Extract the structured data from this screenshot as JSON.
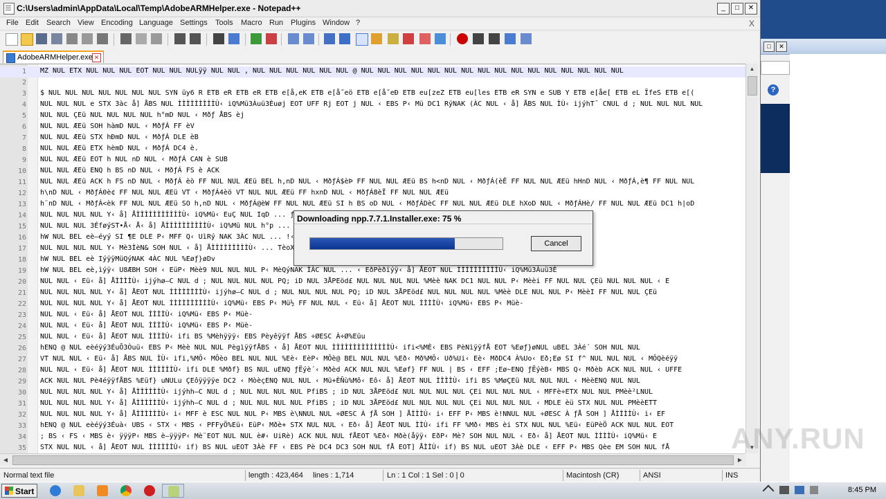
{
  "window": {
    "title": "C:\\Users\\admin\\AppData\\Local\\Temp\\AdobeARMHelper.exe - Notepad++",
    "close_doc": "X"
  },
  "menu": [
    "File",
    "Edit",
    "Search",
    "View",
    "Encoding",
    "Language",
    "Settings",
    "Tools",
    "Macro",
    "Run",
    "Plugins",
    "Window",
    "?"
  ],
  "tab": {
    "label": "AdobeARMHelper.exe"
  },
  "editor": {
    "lines": [
      {
        "n": "1",
        "t": "MZ NUL ETX NUL NUL NUL EOT NUL NUL NULÿÿ NUL NUL , NUL NUL NUL NUL NUL NUL @ NUL NUL NUL NUL NUL NUL NUL NUL NUL NUL NUL NUL NUL NUL NUL NUL"
      },
      {
        "n": "2",
        "t": ""
      },
      {
        "n": "3",
        "t": "$ NUL NUL NUL NUL NUL NUL NUL SYN üy6 R ETB eR ETB eR ETB e[å,eK ETB e[å˝eö ETB e[å˝eÐ ETB eu[zeZ ETB eu[les ETB eR SYN e SUB Y ETB e[åe[ ETB eL ÏfeS ETB e[("
      },
      {
        "n": "4",
        "t": "NUL NUL NUL e STX 3àc å] ÅBS NUL ÌÌÌÌÌÌÌÌÌÙ‹ iQ%Mü3Àuü3Èuøj EOT UFF Rj EOT j NUL ‹ EBS P‹ Mü DC1 RýNAK (ÀC NUL ‹ å] ÅBS NUL ÌÙ‹ ijýhT¯ CNUL d ; NUL NUL NUL NUL"
      },
      {
        "n": "5",
        "t": "NUL NUL ÇEü NUL NUL NUL NUL h°mD NUL ‹ Mðƒ ÅBS èj"
      },
      {
        "n": "6",
        "t": "NUL NUL ÆEü SOH hàmD NUL ‹ MðƒÁ FF èV"
      },
      {
        "n": "7",
        "t": "NUL NUL ÆEü STX hÐmD NUL ‹ MðƒÁ DLE èB"
      },
      {
        "n": "8",
        "t": "NUL NUL ÆEü ETX hèmD NUL ‹ MðƒÁ DC4 è."
      },
      {
        "n": "9",
        "t": "NUL NUL ÆEü EOT h NUL nD NUL ‹ MðƒÁ CAN è SUB"
      },
      {
        "n": "10",
        "t": "NUL NUL ÆEü ENQ h BS nD NUL ‹ MðƒÁ FS è ACK"
      },
      {
        "n": "11",
        "t": "NUL NUL ÆEü ACK h FS nD NUL ‹ MðƒÁ  èò FF NUL NUL ÆEü BEL h,nD NUL ‹ MðƒÁ$èÞ FF NUL NUL ÆEü BS h<nD NUL ‹ MðƒÁ(èÊ FF NUL NUL ÆEü  hHnD NUL ‹ MðƒÁ,è¶ FF NUL NUL"
      },
      {
        "n": "12",
        "t": "h\\nD NUL ‹ MðƒÁ0è¢ FF NUL NUL ÆEü VT ‹ MðƒÁ4èö VT NUL NUL ÆEü FF hxnD NUL ‹ MðƒÁ8èÏ FF NUL NUL ÆEü"
      },
      {
        "n": "13",
        "t": "h¨nD NUL ‹ MðƒÁ<èk FF NUL NUL ÆEü SO h,nD NUL ‹ MðƒÁ@èW FF NUL NUL ÆEü SI h BS oD NUL ‹ MðƒÁDèC FF NUL NUL ÆEü DLE hXoD NUL ‹ MðƒÁHè/ FF NUL NUL ÆEü DC1 h|oD"
      },
      {
        "n": "14",
        "t": "NUL NUL NUL NUL Y‹ å] ÅÌÌÌÌÌÌÌÌÌÌÌÙ‹ iQ%Mü‹ EuÇ NUL IqD ...  ƒÁèT^ NUL NUL ‹ MüƒÁdèI^ NUL NUL"
      },
      {
        "n": "15",
        "t": "NUL NUL NUL 3ÉføýST•Å‹ Å‹ å] ÅÌÌÌÌÌÌÌÌÌÌÙ‹ iQ%Mü NUL h°p ...  üj NUL h°pD NUL ‹ MüƒÁ EOT è°FF NUL"
      },
      {
        "n": "16",
        "t": "hW NUL BEL eè—éyý SI ¶E DLE P‹ MFF Q‹ UìRý NAK 3ÀC NUL ...  !‹ EðƒÁ EOT %Eð‹ MQ‹ UìRýNAK |ÀC"
      },
      {
        "n": "17",
        "t": "NUL NUL NUL NUL Y‹ Mè3ÌèN& SOH NUL ‹ å] ÅÌÌÌÌÌÌÌÌÌÙ‹ ...  TèoX NUL NUL ‹ MüƒÁPèdX NUL NUL ‹"
      },
      {
        "n": "18",
        "t": "hW NUL BEL eè IýÿÿMüQýNAK 4ÀC NUL %Eøƒ}øDv"
      },
      {
        "n": "19",
        "t": "hW NUL BEL eè,ìýÿ‹ U8ÆBH SOH ‹ EüP‹ Mèè9 NUL NUL NUL P‹ MèQýNAK ÌÀC NUL ... ‹ EðPèðïýÿ‹ å] ÅEOT NUL ÌÌÌÌÌÌÌÌÌÌÙ‹ iQ%Mü3Àuü3È"
      },
      {
        "n": "20",
        "t": "NUL NUL ‹ Eü‹ å] ÅÌÌÌÌÙ‹ ijýhø—C NUL d ; NUL NUL NUL NUL PQ; iD NUL 3ÅPEöd£ NUL NUL NUL NUL %Mèè NAK DC1 NUL NUL P‹ Mèèi FF NUL NUL ÇEü NUL NUL NUL ‹ E"
      },
      {
        "n": "21",
        "t": "NUL NUL NUL NUL Y‹ å] ÅEOT NUL ÌÌÌÌÌÌÌÌÙ‹ ijýhø—C NUL d ; NUL NUL NUL NUL PQ; iD NUL 3ÅPEöd£ NUL NUL NUL NUL %Mèè DLE NUL NUL P‹ MèèI FF NUL NUL ÇEü"
      },
      {
        "n": "22",
        "t": "NUL NUL NUL NUL Y‹ å] ÅEOT NUL ÌÌÌÌÌÌÌÌÌÌÙ‹ iQ%Mü‹ EBS P‹ Mü½ FF NUL NUL ‹ Eü‹ å] ÅEOT NUL ÌÌÌÌÙ‹ iQ%Mü‹ EBS P‹ Müè-"
      },
      {
        "n": "23",
        "t": "NUL NUL ‹ Eü‹ å] ÅEOT NUL ÌÌÌÌÙ‹ iQ%Mü‹ EBS P‹ Müè-"
      },
      {
        "n": "24",
        "t": "NUL NUL ‹ Eü‹ å] ÅEOT NUL ÌÌÌÌÙ‹ iQ%Mü‹ EBS P‹ Müè-"
      },
      {
        "n": "25",
        "t": "NUL NUL ‹ Eü‹ å] ÅEOT NUL ÌÌÌÌÙ‹ ifi BS %Mèhÿÿÿ‹ EBS Pèyêÿÿf ÅBS ÷ØESC À÷Ø%Eüu"
      },
      {
        "n": "26",
        "t": "hENQ @ NUL eèéÿý3ÉuÕ3Òuü‹ EBS P‹ Mèè NUL NUL PègìÿÿfÅBS ‹ å] ÅEOT NUL ÌÌÌÌÌÌÌÌÌÌÌÌÌÌÙ‹ ifi<%MÈ‹ EBS PèNìÿÿfÅ EOT %Eøƒ}øNUL uBEL 3Àé´ SOH NUL NUL"
      },
      {
        "n": "27",
        "t": "VT NUL NUL ‹ Eü‹ å] ÅBS NUL ÌÙ‹ ifi,%MÔ‹ MÔèo BEL NUL NUL %Eè‹ EèP‹ MÔè@ BEL NUL NUL %Eð‹ Mð%MÔ‹ Uð%Ui‹ Eè‹ MðDC4 À%Uo‹ Eð;Eø SI f^ NUL NUL NUL ‹ MÔQèéÿÿ"
      },
      {
        "n": "28",
        "t": "NUL NUL ‹ Eü‹ å] ÅEOT NUL ÌÌÌÌÌÌÙ‹ ifi DLE %Mðf} BS NUL uENQ ƒËýè´‹ Mðèd ACK NUL NUL %Eøf} FF NUL | BS ‹ EFF ;Eø~ENQ ƒËýèB‹ MBS Q‹ Mðèb ACK NUL NUL ‹ UFFE"
      },
      {
        "n": "29",
        "t": "ACK NUL NUL Pè4éÿÿfÅBS %Eüf} uNULu ÇEôÿÿÿÿe DC2 ‹ MòèçENQ NUL NUL ‹ Mü+ÈÑù%Mô‹ Eô‹ å] ÅEOT NUL ÌÌÌÌÙ‹ ifi BS %MøÇEü NUL NUL NUL ‹ MèèENQ NUL NUL"
      },
      {
        "n": "30",
        "t": "NUL NUL NUL NUL Y‹ å] ÅÌÌÌÌÌÌÙ‹ ijýhh—C NUL d ; NUL NUL NUL NUL PfiBS ; iD NUL 3ÅPEöd£ NUL NUL NUL NUL ÇEi NUL NUL NUL ‹ MFFè÷ETX NUL NUL PMèè²LNUL"
      },
      {
        "n": "31",
        "t": "NUL NUL NUL NUL Y‹ å] ÅÌÌÌÌÌÌÙ‹ ijýhh—C NUL d ; NUL NUL NUL NUL PfiBS ; iD NUL 3ÅPEöd£ NUL NUL NUL NUL ÇEi NUL NUL NUL ‹ MDLE èü STX NUL NUL PMèèETT"
      },
      {
        "n": "32",
        "t": "NUL NUL NUL NUL Y‹ å] ÅÌÌÌÌÌÌÙ‹ i‹ MFF è ESC NUL NUL P‹ MBS è\\NNUL NUL ÷ØESC À ƒÅ SOH ] ÅÌÌÌÙ‹ i‹ EFF P‹ MBS è!NNUL NUL ÷ØESC À ƒÅ SOH ] ÅÌÌÌÌÙ‹ i‹ EF"
      },
      {
        "n": "33",
        "t": "hENQ @ NUL eèéÿý3Éuà‹ UBS ‹ STX ‹ MBS ‹ PFFyÖ%Eü‹ EüP‹ Mðè+ STX NUL NUL ‹ Eð‹ å] ÅEOT NUL ÌÌÙ‹ ifi FF %Mð‹ MBS èi STX NUL NUL %Eü‹ EüPèÖ ACK NUL NUL EOT"
      },
      {
        "n": "34",
        "t": "; BS ‹ FS ‹ MBS è‹ ÿÿÿP‹ MBS è—ÿÿÿP‹ Mè¨EOT NUL NUL è#‹ UiRè) ACK NUL NUL fÅEOT %Eð‹ Mðè(åÿÿ‹ EðP‹ Mè? SOH NUL NUL ‹ Eð‹ å] ÅEOT NUL ÌÌÌÌÙ‹ iQ%Mü‹ E"
      },
      {
        "n": "35",
        "t": "STX NUL NUL ‹ å] ÅEOT NUL ÌÌÌÌÌÌÙ‹ if) BS NUL uEOT 3Àè FF ‹ EBS Pè DC4 DC3 SOH NUL fÅ EOT] ÅÌÌÙ‹ if) BS NUL uEOT 3Àè DLE ‹ EFF P‹ MBS Qèe EM SOH NUL fÅ"
      }
    ]
  },
  "status": {
    "type": "Normal text file",
    "length": "length : 423,464",
    "lines": "lines : 1,714",
    "pos": "Ln : 1    Col : 1    Sel : 0 | 0",
    "eol": "Macintosh (CR)",
    "enc": "ANSI",
    "mode": "INS"
  },
  "dialog": {
    "title": "Downloading npp.7.7.1.Installer.exe: 75 %",
    "progress": 0.75,
    "cancel": "Cancel"
  },
  "taskbar": {
    "start": "Start",
    "clock": "8:45 PM",
    "apps": [
      "ie-icon",
      "explorer-icon",
      "media-player-icon",
      "chrome-icon",
      "opera-icon",
      "notepadpp-icon"
    ]
  },
  "watermark": "ANY.RUN",
  "colors": {
    "accent": "#f6a31c",
    "progress": "#0b3590",
    "desktop": "#1f4d8c"
  }
}
